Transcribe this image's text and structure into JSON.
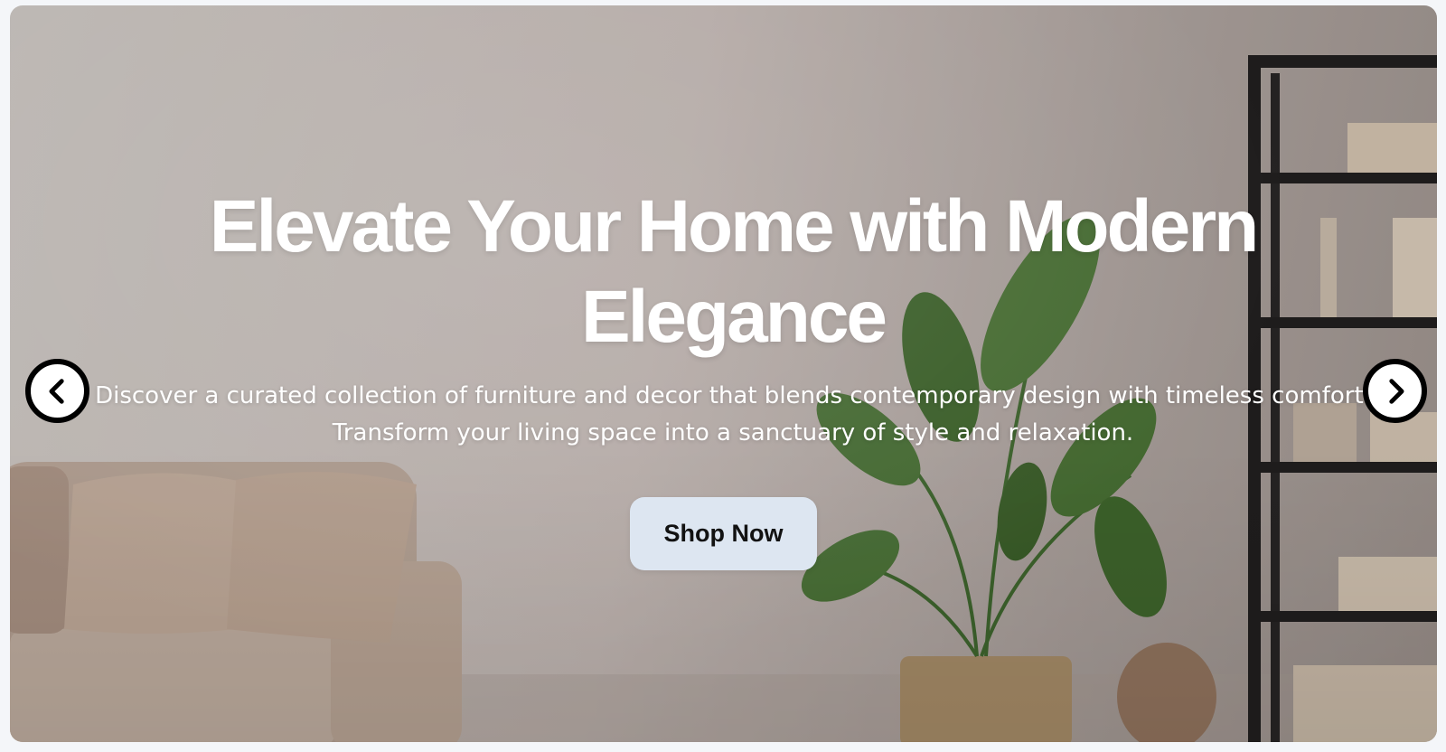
{
  "hero": {
    "headline": "Elevate Your Home with Modern Elegance",
    "subtext_line1": "Discover a curated collection of furniture and decor that blends contemporary design with timeless comfort.",
    "subtext_line2": "Transform your living space into a sanctuary of style and relaxation.",
    "cta_label": "Shop Now"
  },
  "carousel": {
    "prev_icon": "chevron-left-icon",
    "next_icon": "chevron-right-icon"
  },
  "colors": {
    "button_bg": "#dde6f1",
    "text": "#ffffff",
    "nav_border": "#000000"
  }
}
